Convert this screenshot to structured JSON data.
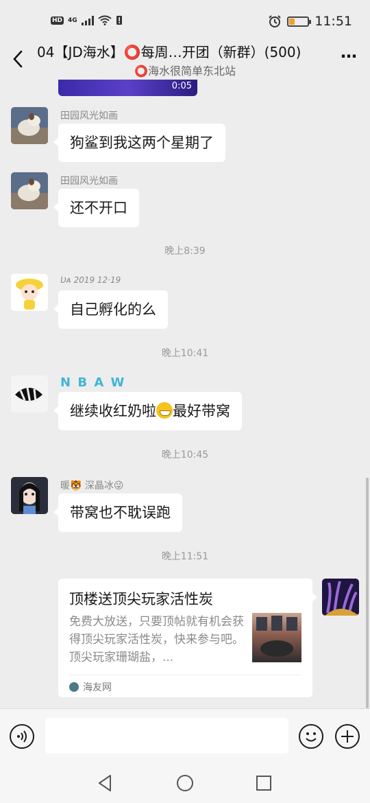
{
  "status_bar": {
    "hd_label": "HD",
    "network_label": "4G",
    "time": "11:51"
  },
  "header": {
    "title": "04【JD海水】⭕每周…开团（新群）(500)",
    "subtitle": "⭕海水很简单东北站",
    "more_label": "…"
  },
  "video": {
    "duration": "0:05"
  },
  "messages": [
    {
      "sender": "田园风光如画",
      "text": "狗鲨到我这两个星期了"
    },
    {
      "sender": "田园风光如画",
      "text": "还不开口"
    },
    {
      "timestamp": "晚上8:39"
    },
    {
      "sender": "Ʋᴀ 2019 12·19",
      "text": "自己孵化的么"
    },
    {
      "timestamp": "晚上10:41"
    },
    {
      "sender": "N B A W",
      "text_before": "继续收红奶啦",
      "text_after": "最好带窝"
    },
    {
      "timestamp": "晚上10:45"
    },
    {
      "sender": "暖🐯 深晶冰😜",
      "text": "带窝也不耽误跑"
    },
    {
      "timestamp": "晚上11:51"
    }
  ],
  "link_card": {
    "title": "顶楼送顶尖玩家活性炭",
    "description": "免费大放送，只要顶帖就有机会获得顶尖玩家活性炭，快来参与吧。顶尖玩家珊瑚盐，...",
    "source": "海友网"
  },
  "input": {
    "placeholder": ""
  },
  "colors": {
    "background": "#ededed",
    "bubble": "#ffffff",
    "nbaw_sender": "#3fb6d6",
    "input_bar": "#f6f6f6"
  }
}
